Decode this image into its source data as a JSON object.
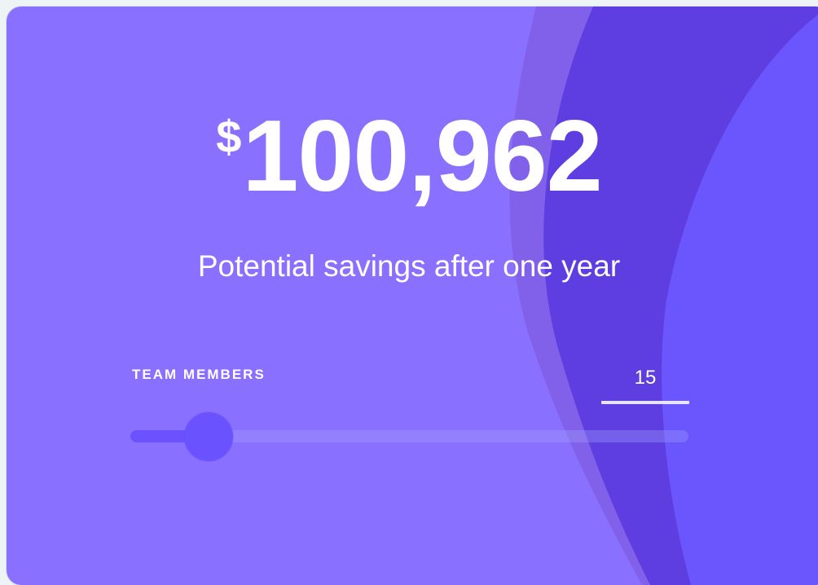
{
  "savings": {
    "currency_symbol": "$",
    "amount": "100,962",
    "subtitle": "Potential savings after one year"
  },
  "team": {
    "label": "TEAM MEMBERS",
    "count": "15",
    "slider_level": 0.14
  },
  "colors": {
    "card_background": "#8a70ff",
    "wave_dark": "#5e3ee0",
    "wave_light": "#6d58ff",
    "slider_accent": "#6a52ff"
  }
}
